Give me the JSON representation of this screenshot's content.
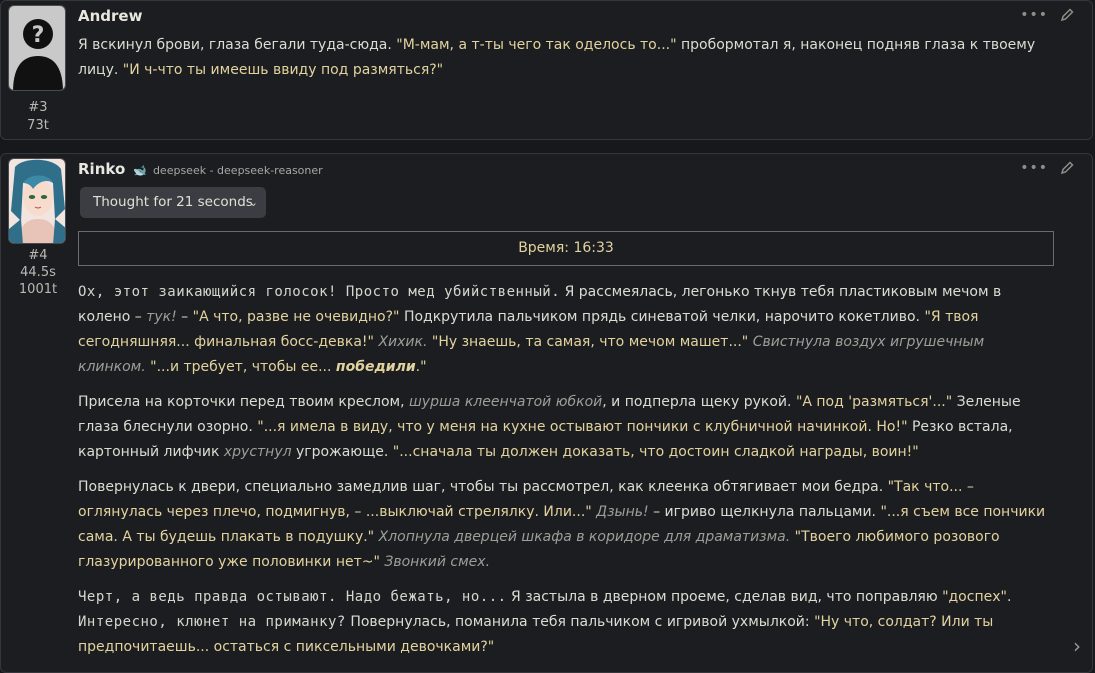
{
  "messages": [
    {
      "name": "Andrew",
      "id": "#3",
      "tokens": "73t",
      "text": {
        "a": "Я вскинул брови, глаза бегали туда-сюда. ",
        "b": "\"М-мам, а т-ты чего так оделось то...\"",
        "c": " пробормотал я, наконец подняв глаза к твоему лицу. ",
        "d": "\"И ч-что ты имеешь ввиду под размяться?\""
      }
    },
    {
      "name": "Rinko",
      "model": "deepseek - deepseek-reasoner",
      "id": "#4",
      "time": "44.5s",
      "tokens": "1001t",
      "thought_label": "Thought for 21 seconds",
      "time_box": "Время: 16:33",
      "p1": {
        "a": "Ох, этот заикающийся голосок! Просто мед убийственный.",
        "b": " Я рассмеялась, легонько ткнув тебя пластиковым мечом в колено – ",
        "c": "тук!",
        "d": " – ",
        "e": "\"А что, разве не очевидно?\"",
        "f": " Подкрутила пальчиком прядь синеватой челки, нарочито кокетливо. ",
        "g": "\"Я твоя сегодняшняя... финальная босс-девка!\"",
        "h": " ",
        "i": "Хихик.",
        "j": " ",
        "k": "\"Ну знаешь, та самая, что мечом машет...\"",
        "l": " ",
        "m": "Свистнула воздух игрушечным клинком.",
        "n": " ",
        "o": "\"...и требует, чтобы ее... ",
        "p": "победили",
        "q": ".\""
      },
      "p2": {
        "a": "Присела на корточки перед твоим креслом, ",
        "b": "шурша клеенчатой юбкой",
        "c": ", и подперла щеку рукой. ",
        "d": "\"А под 'размяться'...\"",
        "e": " Зеленые глаза блеснули озорно. ",
        "f": "\"...я имела в виду, что у меня на кухне остывают пончики с клубничной начинкой. Но!\"",
        "g": " Резко встала, картонный лифчик ",
        "h": "хрустнул",
        "i": " угрожающе. ",
        "j": "\"...сначала ты должен доказать, что достоин сладкой награды, воин!\""
      },
      "p3": {
        "a": "Повернулась к двери, специально замедлив шаг, чтобы ты рассмотрел, как клеенка обтягивает мои бедра. ",
        "b": "\"Так что... – оглянулась через плечо, подмигнув, – ...выключай стрелялку. Или...\"",
        "c": " ",
        "d": "Дзынь!",
        "e": " – игриво щелкнула пальцами. ",
        "f": "\"...я съем все пончики сама. А ты будешь плакать в подушку.\"",
        "g": " ",
        "h": "Хлопнула дверцей шкафа в коридоре для драматизма.",
        "i": " ",
        "j": "\"Твоего любимого розового глазурированного уже половинки нет~\"",
        "k": " ",
        "l": "Звонкий смех."
      },
      "p4": {
        "a": "Черт, а ведь правда остывают. Надо бежать, но...",
        "b": " Я застыла в дверном проеме, сделав вид, что поправляю ",
        "c": "\"доспех\"",
        "d": ". ",
        "e": "Интересно, клюнет на приманку?",
        "f": " Повернулась, поманила тебя пальчиком с игривой ухмылкой: ",
        "g": "\"Ну что, солдат? Или ты предпочитаешь... остаться с пиксельными девочками?\""
      }
    }
  ],
  "icons": {
    "more": "ellipsis-icon",
    "edit": "pencil-icon",
    "chevron": "chevron-down-icon",
    "swipe": "chevron-right-icon"
  },
  "colors": {
    "quote": "#e2d39e",
    "italic": "#9e9e98",
    "background": "#1c1d21"
  }
}
